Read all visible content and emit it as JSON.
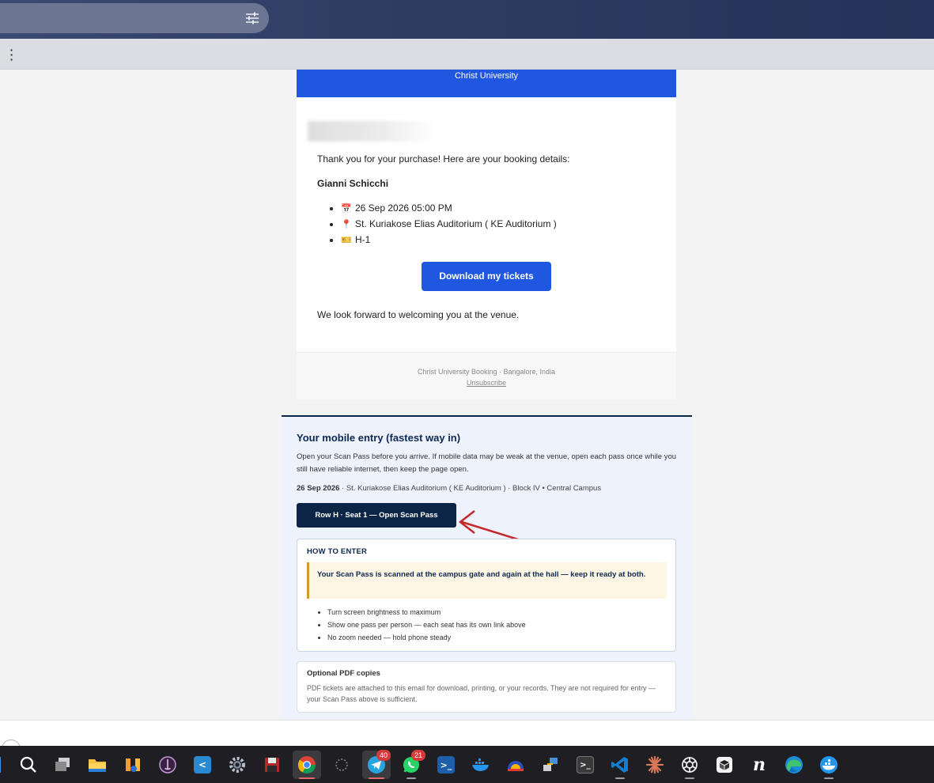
{
  "browser": {
    "search_icon": "tune-icon",
    "menu_icon": "kebab-menu-icon"
  },
  "email": {
    "banner": "Christ University",
    "intro": "Thank you for your purchase! Here are your booking details:",
    "event_name": "Gianni Schicchi",
    "details": [
      {
        "icon": "calendar-icon",
        "text": "26 Sep 2026 05:00 PM"
      },
      {
        "icon": "pin-icon",
        "text": "St. Kuriakose Elias Auditorium ( KE Auditorium )"
      },
      {
        "icon": "ticket-icon",
        "text": "H-1"
      }
    ],
    "download_button": "Download my tickets",
    "closing": "We look forward to welcoming you at the venue.",
    "footer_org": "Christ University Booking · Bangalore, India",
    "footer_unsubscribe": "Unsubscribe"
  },
  "mobile_entry": {
    "title": "Your mobile entry (fastest way in)",
    "description": "Open your Scan Pass before you arrive. If mobile data may be weak at the venue, open each pass once while you still have reliable internet, then keep the page open.",
    "date": "26 Sep 2026",
    "venue": " · St. Kuriakose Elias Auditorium ( KE Auditorium ) · Block IV • Central Campus",
    "scan_button": "Row H · Seat 1 — Open Scan Pass",
    "how_title": "HOW TO ENTER",
    "how_note": "Your Scan Pass is scanned at the campus gate and again at the hall — keep it ready at both.",
    "how_steps": [
      "Turn screen brightness to maximum",
      "Show one pass per person — each seat has its own link above",
      "No zoom needed — hold phone steady"
    ],
    "pdf_title": "Optional PDF copies",
    "pdf_body": "PDF tickets are attached to this email for download, printing, or your records. They are not required for entry — your Scan Pass above is sufficient."
  },
  "colors": {
    "brand_blue": "#1f57e0",
    "navy": "#0c2446",
    "annotation_arrow": "#c62828"
  },
  "taskbar": {
    "items": [
      {
        "name": "search",
        "icon": "search-icon"
      },
      {
        "name": "task-view",
        "icon": "task-view-icon"
      },
      {
        "name": "file-explorer",
        "icon": "folder-icon"
      },
      {
        "name": "music-app",
        "icon": "music-icon"
      },
      {
        "name": "audio-editor",
        "icon": "audio-editor-icon"
      },
      {
        "name": "code-tool",
        "icon": "code-tool-icon"
      },
      {
        "name": "settings",
        "icon": "gear-icon"
      },
      {
        "name": "save-app",
        "icon": "floppy-icon"
      },
      {
        "name": "chrome",
        "icon": "chrome-icon"
      },
      {
        "name": "loading",
        "icon": "spinner-icon"
      },
      {
        "name": "telegram",
        "icon": "telegram-icon",
        "badge": "40"
      },
      {
        "name": "whatsapp",
        "icon": "whatsapp-icon",
        "badge": "21"
      },
      {
        "name": "powershell",
        "icon": "powershell-icon"
      },
      {
        "name": "docker",
        "icon": "docker-icon"
      },
      {
        "name": "vpn",
        "icon": "vpn-icon"
      },
      {
        "name": "network",
        "icon": "network-icon"
      },
      {
        "name": "terminal",
        "icon": "terminal-icon"
      },
      {
        "name": "vscode",
        "icon": "vscode-icon"
      },
      {
        "name": "claude",
        "icon": "claude-icon"
      },
      {
        "name": "chatgpt",
        "icon": "chatgpt-icon"
      },
      {
        "name": "cube-app",
        "icon": "cube-icon"
      },
      {
        "name": "notion",
        "icon": "notion-icon"
      },
      {
        "name": "edge",
        "icon": "edge-icon"
      },
      {
        "name": "docker-desktop",
        "icon": "docker-desktop-icon"
      }
    ]
  }
}
